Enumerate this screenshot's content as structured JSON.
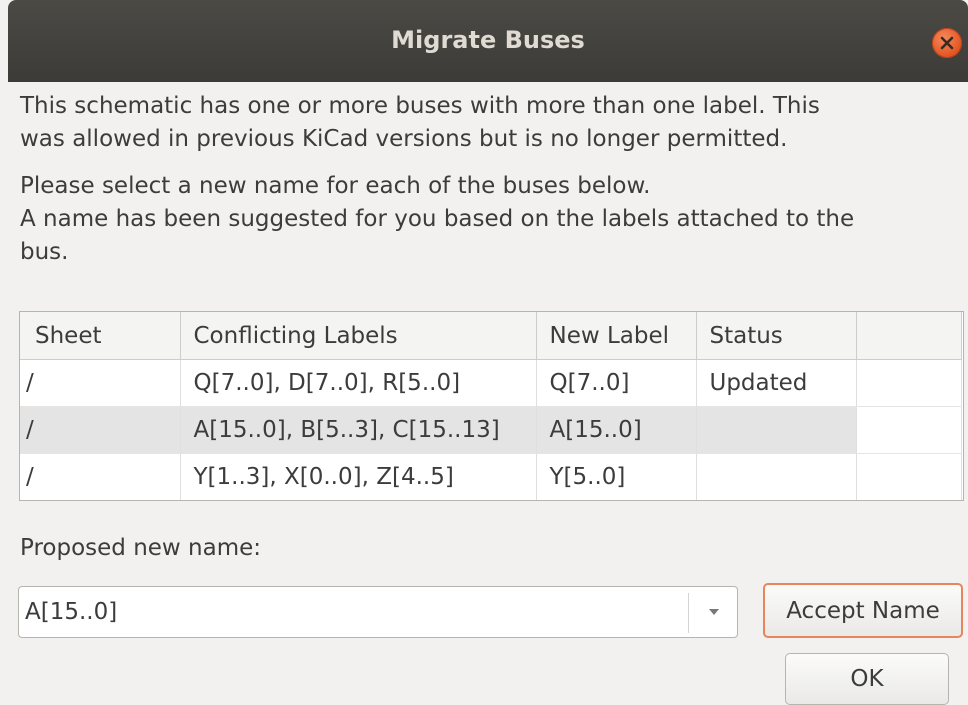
{
  "window": {
    "title": "Migrate Buses"
  },
  "intro": {
    "line1": "This schematic has one or more buses with more than one label.  This",
    "line2": "was allowed in previous KiCad versions but is no longer permitted.",
    "line3": "Please select a new name for each of the buses below.",
    "line4": "A name has been suggested for you based on the labels attached to the",
    "line5": "bus."
  },
  "table": {
    "headers": [
      "Sheet",
      "Conflicting Labels",
      "New Label",
      "Status",
      ""
    ],
    "rows": [
      {
        "sheet": "/",
        "conflicting": "Q[7..0], D[7..0], R[5..0]",
        "new_label": "Q[7..0]",
        "status": "Updated"
      },
      {
        "sheet": "/",
        "conflicting": "A[15..0], B[5..3], C[15..13]",
        "new_label": "A[15..0]",
        "status": ""
      },
      {
        "sheet": "/",
        "conflicting": "Y[1..3], X[0..0], Z[4..5]",
        "new_label": "Y[5..0]",
        "status": ""
      }
    ],
    "selected_row": 1
  },
  "proposed": {
    "label": "Proposed new name:",
    "value": "A[15..0]"
  },
  "buttons": {
    "accept": "Accept Name",
    "ok": "OK"
  },
  "colors": {
    "titlebar": "#3c3b37",
    "close": "#e2531f",
    "accent_border": "#e7855c",
    "selected_row": "#e4e4e4"
  }
}
